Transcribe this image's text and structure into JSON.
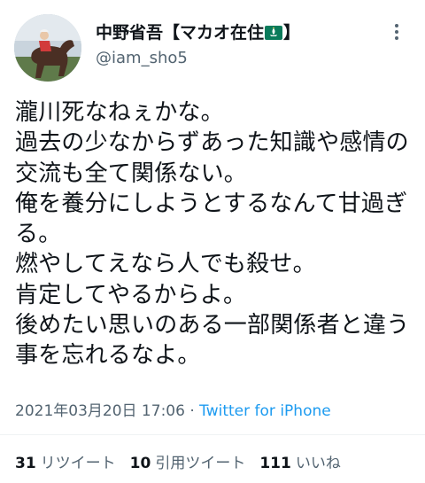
{
  "user": {
    "display_name_prefix": "中野省吾【マカオ在住",
    "display_name_suffix": "】",
    "handle": "@iam_sho5"
  },
  "icons": {
    "flag": "macau-flag-icon",
    "more": "more-options-icon",
    "avatar": "jockey-on-horse-avatar"
  },
  "tweet": {
    "text": "瀧川死なねぇかな。\n過去の少なからずあった知識や感情の交流も全て関係ない。\n俺を養分にしようとするなんて甘過ぎる。\n燃やしてえなら人でも殺せ。\n肯定してやるからよ。\n後めたい思いのある一部関係者と違う事を忘れるなよ。",
    "timestamp": "2021年03月20日 17:06",
    "separator": " · ",
    "source": "Twitter for iPhone"
  },
  "stats": [
    {
      "count": "31",
      "label": "リツイート"
    },
    {
      "count": "10",
      "label": "引用ツイート"
    },
    {
      "count": "111",
      "label": "いいね"
    }
  ],
  "colors": {
    "text": "#0f1419",
    "secondary": "#536471",
    "link": "#1d9bf0",
    "flag_green": "#0a7b5b"
  }
}
